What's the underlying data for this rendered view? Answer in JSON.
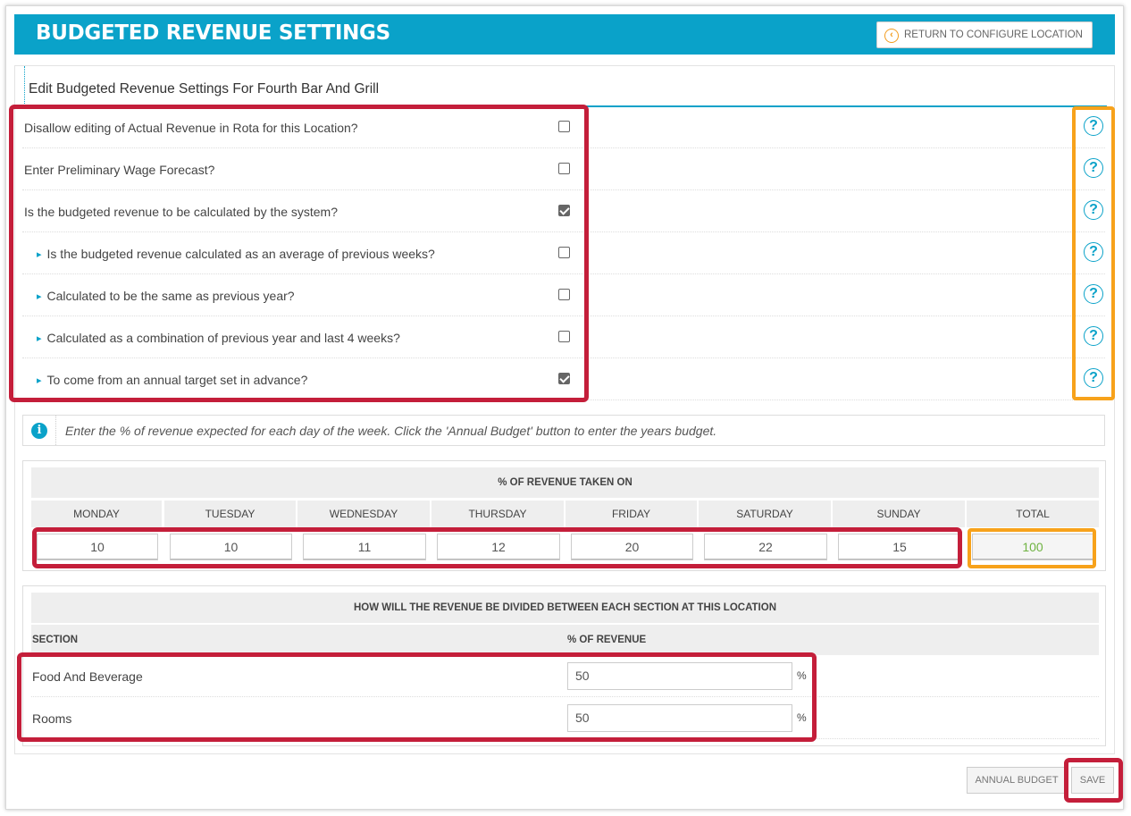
{
  "header": {
    "title": "BUDGETED REVENUE SETTINGS",
    "return_label": "RETURN TO CONFIGURE LOCATION"
  },
  "panel": {
    "title": "Edit Budgeted Revenue Settings For Fourth Bar And Grill"
  },
  "settings": [
    {
      "label": "Disallow editing of Actual Revenue in Rota for this Location?",
      "checked": false,
      "sub": false
    },
    {
      "label": "Enter Preliminary Wage Forecast?",
      "checked": false,
      "sub": false
    },
    {
      "label": "Is the budgeted revenue to be calculated by the system?",
      "checked": true,
      "sub": false
    },
    {
      "label": "Is the budgeted revenue calculated as an average of previous weeks?",
      "checked": false,
      "sub": true
    },
    {
      "label": "Calculated to be the same as previous year?",
      "checked": false,
      "sub": true
    },
    {
      "label": "Calculated as a combination of previous year and last 4 weeks?",
      "checked": false,
      "sub": true
    },
    {
      "label": "To come from an annual target set in advance?",
      "checked": true,
      "sub": true
    }
  ],
  "help_glyph": "?",
  "info": {
    "icon_glyph": "i",
    "text": "Enter the % of revenue expected for each day of the week. Click the 'Annual Budget' button to enter the years budget."
  },
  "revenue_days": {
    "heading": "% OF REVENUE TAKEN ON",
    "days": [
      "MONDAY",
      "TUESDAY",
      "WEDNESDAY",
      "THURSDAY",
      "FRIDAY",
      "SATURDAY",
      "SUNDAY"
    ],
    "values": [
      "10",
      "10",
      "11",
      "12",
      "20",
      "22",
      "15"
    ],
    "total_label": "TOTAL",
    "total_value": "100"
  },
  "sections": {
    "heading": "HOW WILL THE REVENUE BE DIVIDED BETWEEN EACH SECTION AT THIS LOCATION",
    "col_section": "SECTION",
    "col_pct": "% OF REVENUE",
    "rows": [
      {
        "name": "Food And Beverage",
        "value": "50",
        "unit": "%"
      },
      {
        "name": "Rooms",
        "value": "50",
        "unit": "%"
      }
    ]
  },
  "buttons": {
    "annual_budget": "ANNUAL BUDGET",
    "save": "SAVE"
  },
  "colors": {
    "brand": "#0aa2c9",
    "highlight_red": "#c41e3a",
    "highlight_orange": "#f7a21b",
    "total_green": "#6fb342"
  }
}
